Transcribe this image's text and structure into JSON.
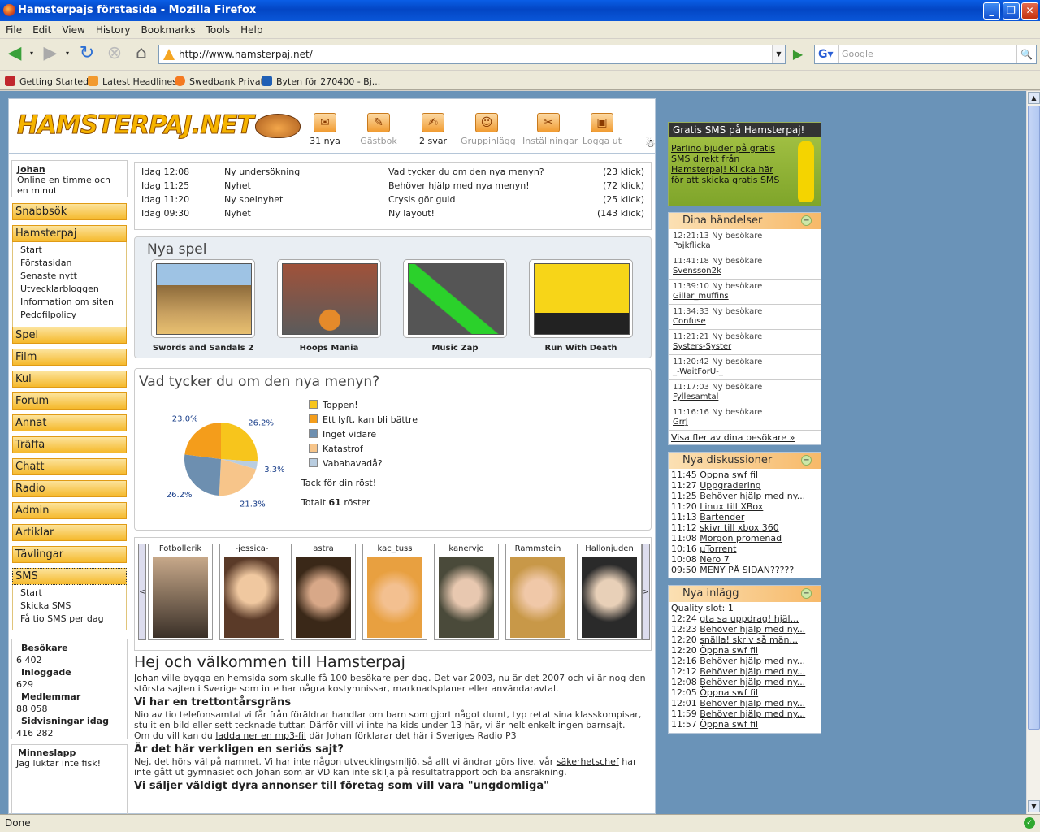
{
  "window": {
    "title": "Hamsterpajs förstasida - Mozilla Firefox"
  },
  "menu": [
    "File",
    "Edit",
    "View",
    "History",
    "Bookmarks",
    "Tools",
    "Help"
  ],
  "nav": {
    "url": "http://www.hamsterpaj.net/",
    "search_placeholder": "Google"
  },
  "bookmarks": [
    "Getting Started",
    "Latest Headlines",
    "Swedbank Privat",
    "Byten för 270400 - Bj..."
  ],
  "status": "Done",
  "site": {
    "logo": "HAMSTERPAJ.NET",
    "top_icons": [
      {
        "label": "31 nya"
      },
      {
        "label": "Gästbok"
      },
      {
        "label": "2 svar"
      },
      {
        "label": "Gruppinlägg"
      },
      {
        "label": "Inställningar"
      },
      {
        "label": "Logga ut"
      }
    ],
    "user": {
      "name": "Johan",
      "status": "Online en timme och en minut"
    },
    "nav": {
      "snabbsok": "Snabbsök",
      "hamsterpaj": "Hamsterpaj",
      "hamsterpaj_sub": [
        "Start",
        "Förstasidan",
        "Senaste nytt",
        "Utvecklarbloggen",
        "Information om siten",
        "Pedofilpolicy"
      ],
      "items": [
        "Spel",
        "Film",
        "Kul",
        "Forum",
        "Annat",
        "Träffa",
        "Chatt",
        "Radio",
        "Admin",
        "Artiklar",
        "Tävlingar"
      ],
      "sms": "SMS",
      "sms_sub": [
        "Start",
        "Skicka SMS",
        "Få tio SMS per dag"
      ]
    },
    "stats": [
      {
        "label": "Besökare",
        "value": "6 402"
      },
      {
        "label": "Inloggade",
        "value": "629"
      },
      {
        "label": "Medlemmar",
        "value": "88 058"
      },
      {
        "label": "Sidvisningar idag",
        "value": "416 282"
      }
    ],
    "memo": {
      "title": "Minneslapp",
      "text": "Jag luktar inte fisk!"
    },
    "news": [
      {
        "time": "Idag 12:08",
        "type": "Ny undersökning",
        "title": "Vad tycker du om den nya menyn?",
        "clicks": "(23 klick)"
      },
      {
        "time": "Idag 11:25",
        "type": "Nyhet",
        "title": "Behöver hjälp med nya menyn!",
        "clicks": "(72 klick)"
      },
      {
        "time": "Idag 11:20",
        "type": "Ny spelnyhet",
        "title": "Crysis gör guld",
        "clicks": "(25 klick)"
      },
      {
        "time": "Idag 09:30",
        "type": "Nyhet",
        "title": "Ny layout!",
        "clicks": "(143 klick)"
      }
    ],
    "games": {
      "title": "Nya spel",
      "items": [
        "Swords and Sandals 2",
        "Hoops Mania",
        "Music Zap",
        "Run With Death"
      ]
    },
    "poll": {
      "title": "Vad tycker du om den nya menyn?",
      "options": [
        {
          "label": "Toppen!",
          "pct": 26.2,
          "pct_label": "26.2%",
          "color": "#f7c51c"
        },
        {
          "label": "Ett lyft, kan bli bättre",
          "pct": 23.0,
          "pct_label": "23.0%",
          "color": "#f49d1b"
        },
        {
          "label": "Inget vidare",
          "pct": 26.2,
          "pct_label": "26.2%",
          "color": "#6d8fb0"
        },
        {
          "label": "Katastrof",
          "pct": 21.3,
          "pct_label": "21.3%",
          "color": "#f7c58a"
        },
        {
          "label": "Vababavadå?",
          "pct": 3.3,
          "pct_label": "3.3%",
          "color": "#b9cde0"
        }
      ],
      "thanks": "Tack för din röst!",
      "total_pre": "Totalt",
      "total": "61",
      "total_post": "röster"
    },
    "photos": [
      "Fotbollerik",
      "-jessica-",
      "astra",
      "kac_tuss",
      "kanervjo",
      "Rammstein",
      "Hallonjuden"
    ],
    "welcome": {
      "title": "Hej och välkommen till Hamsterpaj",
      "p1_link": "Johan",
      "p1": " ville bygga en hemsida som skulle få 100 besökare per dag. Det var 2003, nu är det 2007 och vi är nog den största sajten i Sverige som inte har några kostymnissar, marknadsplaner eller användaravtal.",
      "h2": "Vi har en trettontårsgräns",
      "p2": "Nio av tio telefonsamtal vi får från föräldrar handlar om barn som gjort något dumt, typ retat sina klasskompisar, stulit en bild eller sett tecknade tuttar. Därför vill vi inte ha kids under 13 här, vi är helt enkelt ingen barnsajt.",
      "p3_pre": "Om du vill kan du ",
      "p3_link": "ladda ner en mp3-fil",
      "p3_post": " där Johan förklarar det här i Sveriges Radio P3",
      "h3": "Är det här verkligen en seriös sajt?",
      "p4_pre": "Nej, det hörs väl på namnet. Vi har inte någon utvecklingsmiljö, så allt vi ändrar görs live, vår ",
      "p4_link": "säkerhetschef",
      "p4_post": " har inte gått ut gymnasiet och Johan som är VD kan inte skilja på resultatrapport och balansräkning.",
      "h4": "Vi säljer väldigt dyra annonser till företag som vill vara \"ungdomliga\""
    },
    "sms_ad": {
      "title": "Gratis SMS på Hamsterpaj!",
      "text": "Parlino bjuder på gratis SMS direkt från Hamsterpaj! Klicka här för att skicka gratis SMS"
    },
    "events": {
      "title": "Dina händelser",
      "items": [
        {
          "time": "12:21:13",
          "text": "Ny besökare",
          "user": "Pojkflicka"
        },
        {
          "time": "11:41:18",
          "text": "Ny besökare",
          "user": "Svensson2k"
        },
        {
          "time": "11:39:10",
          "text": "Ny besökare",
          "user": "Gillar_muffins"
        },
        {
          "time": "11:34:33",
          "text": "Ny besökare",
          "user": "Confuse"
        },
        {
          "time": "11:21:21",
          "text": "Ny besökare",
          "user": "Systers-Syster"
        },
        {
          "time": "11:20:42",
          "text": "Ny besökare",
          "user": "_-WaitForU-_"
        },
        {
          "time": "11:17:03",
          "text": "Ny besökare",
          "user": "Fyllesamtal"
        },
        {
          "time": "11:16:16",
          "text": "Ny besökare",
          "user": "GrrJ"
        }
      ],
      "more": "Visa fler av dina besökare »"
    },
    "discussions": {
      "title": "Nya diskussioner",
      "items": [
        {
          "time": "11:45",
          "text": "Öppna swf fil"
        },
        {
          "time": "11:27",
          "text": "Uppgradering"
        },
        {
          "time": "11:25",
          "text": "Behöver hjälp med ny..."
        },
        {
          "time": "11:20",
          "text": "Linux till XBox"
        },
        {
          "time": "11:13",
          "text": "Bartender"
        },
        {
          "time": "11:12",
          "text": "skivr till xbox 360"
        },
        {
          "time": "11:08",
          "text": "Morgon promenad"
        },
        {
          "time": "10:16",
          "text": "µTorrent"
        },
        {
          "time": "10:08",
          "text": "Nero 7"
        },
        {
          "time": "09:50",
          "text": "MENY PÅ SIDAN?????"
        }
      ]
    },
    "posts": {
      "title": "Nya inlägg",
      "quality": "Quality slot: 1",
      "items": [
        {
          "time": "12:24",
          "text": "gta sa uppdrag! hjäl..."
        },
        {
          "time": "12:23",
          "text": "Behöver hjälp med ny..."
        },
        {
          "time": "12:20",
          "text": "snälla! skriv så män..."
        },
        {
          "time": "12:20",
          "text": "Öppna swf fil"
        },
        {
          "time": "12:16",
          "text": "Behöver hjälp med ny..."
        },
        {
          "time": "12:12",
          "text": "Behöver hjälp med ny..."
        },
        {
          "time": "12:08",
          "text": "Behöver hjälp med ny..."
        },
        {
          "time": "12:05",
          "text": "Öppna swf fil"
        },
        {
          "time": "12:01",
          "text": "Behöver hjälp med ny..."
        },
        {
          "time": "11:59",
          "text": "Behöver hjälp med ny..."
        },
        {
          "time": "11:57",
          "text": "Öppna swf fil"
        }
      ]
    }
  }
}
